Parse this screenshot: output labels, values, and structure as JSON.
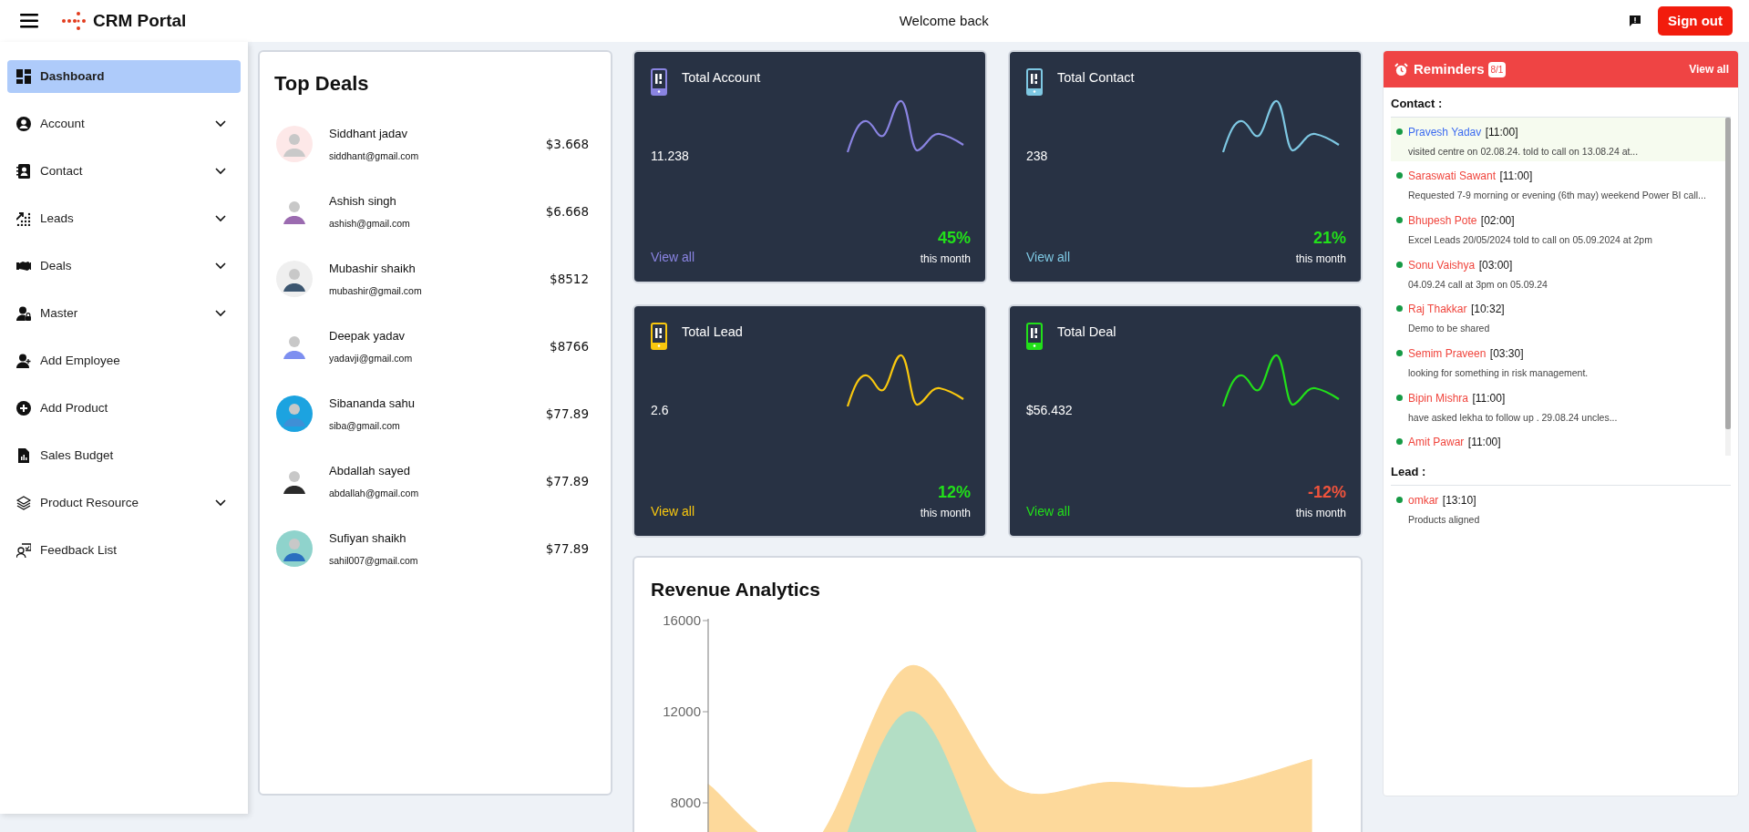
{
  "header": {
    "title": "CRM Portal",
    "greeting": "Welcome back",
    "sign_out": "Sign out"
  },
  "sidebar": {
    "items": [
      {
        "label": "Dashboard",
        "selected": true,
        "expandable": false
      },
      {
        "label": "Account",
        "selected": false,
        "expandable": true
      },
      {
        "label": "Contact",
        "selected": false,
        "expandable": true
      },
      {
        "label": "Leads",
        "selected": false,
        "expandable": true
      },
      {
        "label": "Deals",
        "selected": false,
        "expandable": true
      },
      {
        "label": "Master",
        "selected": false,
        "expandable": true
      },
      {
        "label": "Add Employee",
        "selected": false,
        "expandable": false
      },
      {
        "label": "Add Product",
        "selected": false,
        "expandable": false
      },
      {
        "label": "Sales Budget",
        "selected": false,
        "expandable": false
      },
      {
        "label": "Product Resource",
        "selected": false,
        "expandable": true
      },
      {
        "label": "Feedback List",
        "selected": false,
        "expandable": false
      }
    ]
  },
  "top_deals": {
    "title": "Top Deals",
    "deals": [
      {
        "name": "Siddhant jadav",
        "email": "siddhant@gmail.com",
        "amount": "$3.668"
      },
      {
        "name": "Ashish singh",
        "email": "ashish@gmail.com",
        "amount": "$6.668"
      },
      {
        "name": "Mubashir shaikh",
        "email": "mubashir@gmail.com",
        "amount": "$8512"
      },
      {
        "name": "Deepak yadav",
        "email": "yadavji@gmail.com",
        "amount": "$8766"
      },
      {
        "name": "Sibananda sahu",
        "email": "siba@gmail.com",
        "amount": "$77.89"
      },
      {
        "name": "Abdallah sayed",
        "email": "abdallah@gmail.com",
        "amount": "$77.89"
      },
      {
        "name": "Sufiyan shaikh",
        "email": "sahil007@gmail.com",
        "amount": "$77.89"
      }
    ]
  },
  "stats": [
    {
      "title": "Total Account",
      "value": "11.238",
      "change": "45%",
      "positive": true,
      "period": "this month",
      "link": "View all",
      "color": "#8a84e2"
    },
    {
      "title": "Total Contact",
      "value": "238",
      "change": "21%",
      "positive": true,
      "period": "this month",
      "link": "View all",
      "color": "#7ec8e3"
    },
    {
      "title": "Total Lead",
      "value": "2.6",
      "change": "12%",
      "positive": true,
      "period": "this month",
      "link": "View all",
      "color": "#f9c80e"
    },
    {
      "title": "Total Deal",
      "value": "$56.432",
      "change": "-12%",
      "positive": false,
      "period": "this month",
      "link": "View all",
      "color": "#22e01a"
    }
  ],
  "revenue": {
    "title": "Revenue Analytics",
    "chart_data": {
      "type": "area",
      "stacked": false,
      "ylim": [
        0,
        16000
      ],
      "yticks": [
        8000,
        12000,
        16000
      ],
      "series": [
        {
          "color": "#fdd99b",
          "values": [
            8800,
            6000,
            14000,
            8700,
            8900,
            8700,
            9900
          ]
        },
        {
          "color": "#b3dec5",
          "values": [
            2000,
            3000,
            12000,
            4000,
            4000,
            4000,
            4000
          ]
        }
      ]
    }
  },
  "reminders": {
    "title": "Reminders",
    "badge": "8/1",
    "view_all": "View all",
    "sections": [
      {
        "title": "Contact :",
        "scrollable": true,
        "items": [
          {
            "name": "Pravesh Yadav",
            "time": "[11:00]",
            "note": "visited centre on 02.08.24. told to call on 13.08.24 at...",
            "selected": true
          },
          {
            "name": "Saraswati Sawant",
            "time": "[11:00]",
            "note": "Requested 7-9 morning or evening (6th may) weekend Power BI call...",
            "selected": false
          },
          {
            "name": "Bhupesh Pote",
            "time": "[02:00]",
            "note": "Excel Leads 20/05/2024 told to call on 05.09.2024 at 2pm",
            "selected": false
          },
          {
            "name": "Sonu Vaishya",
            "time": "[03:00]",
            "note": "04.09.24 call at 3pm on 05.09.24",
            "selected": false
          },
          {
            "name": "Raj Thakkar",
            "time": "[10:32]",
            "note": "Demo to be shared",
            "selected": false
          },
          {
            "name": "Semim Praveen",
            "time": "[03:30]",
            "note": "looking for something in risk management.",
            "selected": false
          },
          {
            "name": "Bipin Mishra",
            "time": "[11:00]",
            "note": "have asked lekha to follow up . 29.08.24 uncles...",
            "selected": false
          },
          {
            "name": "Amit Pawar",
            "time": "[11:00]",
            "selected": false
          }
        ]
      },
      {
        "title": "Lead :",
        "scrollable": false,
        "items": [
          {
            "name": "omkar",
            "time": "[13:10]",
            "note": "Products aligned",
            "selected": false
          }
        ]
      }
    ]
  }
}
